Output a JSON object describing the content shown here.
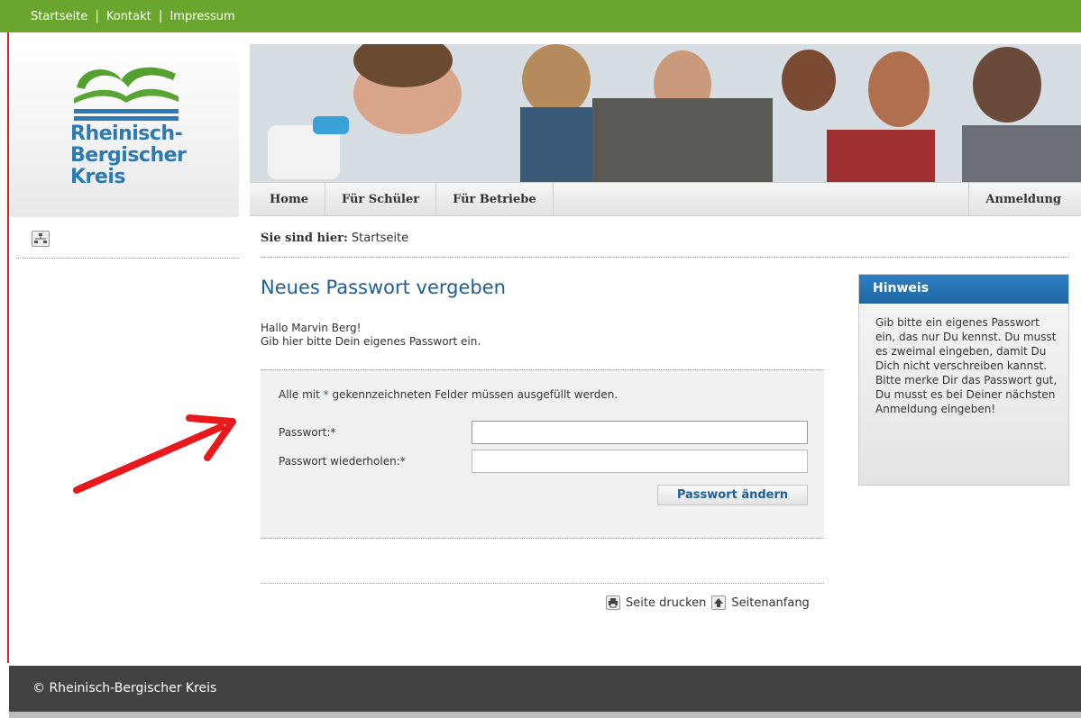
{
  "topnav": {
    "links": [
      "Startseite",
      "Kontakt",
      "Impressum"
    ],
    "separator": "|"
  },
  "logo": {
    "line1": "Rheinisch-",
    "line2": "Bergischer",
    "line3": "Kreis"
  },
  "mainnav": {
    "home": "Home",
    "schueler": "Für Schüler",
    "betriebe": "Für Betriebe",
    "anmeldung": "Anmeldung"
  },
  "breadcrumb": {
    "prefix": "Sie sind hier:",
    "current": "Startseite"
  },
  "page": {
    "title": "Neues Passwort vergeben",
    "greeting_line1": "Hallo Marvin Berg!",
    "greeting_line2": "Gib hier bitte Dein eigenes Passwort ein."
  },
  "form": {
    "required_note_pre": "Alle mit ",
    "required_star": "*",
    "required_note_post": " gekennzeichneten Felder müssen ausgefüllt werden.",
    "password_label": "Passwort:*",
    "password_value": "",
    "repeat_label": "Passwort wiederholen:*",
    "repeat_value": "",
    "submit_label": "Passwort ändern"
  },
  "tools": {
    "print": "Seite drucken",
    "top": "Seitenanfang"
  },
  "hint": {
    "title": "Hinweis",
    "text": "Gib bitte ein eigenes Passwort ein, das nur Du kennst. Du musst es zweimal eingeben, damit Du Dich nicht verschreiben kannst. Bitte merke Dir das Passwort gut, Du musst es bei Deiner nächsten Anmeldung eingeben!"
  },
  "footer": {
    "copyright": "© Rheinisch-Bergischer Kreis"
  },
  "colors": {
    "topbar": "#6aa62d",
    "accent": "#1f5f99",
    "hint_header": "#2a78b9",
    "footer": "#424242",
    "arrow": "#e8191c"
  }
}
